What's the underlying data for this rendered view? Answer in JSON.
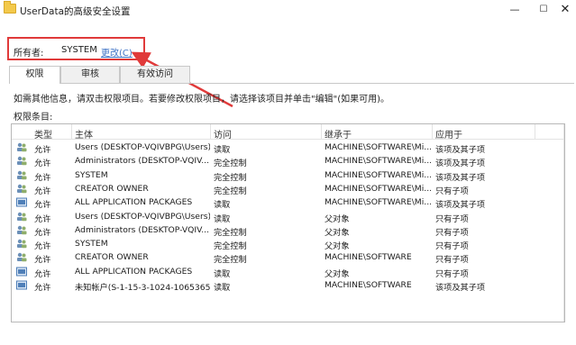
{
  "window": {
    "title": "UserData的高级安全设置",
    "minimize": "—",
    "maximize": "☐",
    "close": "✕"
  },
  "owner": {
    "label": "所有者:",
    "value": "SYSTEM",
    "change_link": "更改(C)"
  },
  "tabs": [
    {
      "label": "权限",
      "active": true
    },
    {
      "label": "审核",
      "active": false
    },
    {
      "label": "有效访问",
      "active": false
    }
  ],
  "instructions": "如需其他信息，请双击权限项目。若要修改权限项目，请选择该项目并单击\"编辑\"(如果可用)。",
  "entries_label": "权限条目:",
  "table": {
    "headers": [
      "类型",
      "主体",
      "访问",
      "继承于",
      "应用于"
    ],
    "rows": [
      {
        "icon": "users-icon",
        "type": "允许",
        "principal": "Users (DESKTOP-VQIVBPG\\Users)",
        "access": "读取",
        "inherited": "MACHINE\\SOFTWARE\\Mi...",
        "applies": "该项及其子项"
      },
      {
        "icon": "users-icon",
        "type": "允许",
        "principal": "Administrators (DESKTOP-VQIV...",
        "access": "完全控制",
        "inherited": "MACHINE\\SOFTWARE\\Mi...",
        "applies": "该项及其子项"
      },
      {
        "icon": "users-icon",
        "type": "允许",
        "principal": "SYSTEM",
        "access": "完全控制",
        "inherited": "MACHINE\\SOFTWARE\\Mi...",
        "applies": "该项及其子项"
      },
      {
        "icon": "users-icon",
        "type": "允许",
        "principal": "CREATOR OWNER",
        "access": "完全控制",
        "inherited": "MACHINE\\SOFTWARE\\Mi...",
        "applies": "只有子项"
      },
      {
        "icon": "package-icon",
        "type": "允许",
        "principal": "ALL APPLICATION PACKAGES",
        "access": "读取",
        "inherited": "MACHINE\\SOFTWARE\\Mi...",
        "applies": "该项及其子项"
      },
      {
        "icon": "users-icon",
        "type": "允许",
        "principal": "Users (DESKTOP-VQIVBPG\\Users)",
        "access": "读取",
        "inherited": "父对象",
        "applies": "只有子项"
      },
      {
        "icon": "users-icon",
        "type": "允许",
        "principal": "Administrators (DESKTOP-VQIV...",
        "access": "完全控制",
        "inherited": "父对象",
        "applies": "只有子项"
      },
      {
        "icon": "users-icon",
        "type": "允许",
        "principal": "SYSTEM",
        "access": "完全控制",
        "inherited": "父对象",
        "applies": "只有子项"
      },
      {
        "icon": "users-icon",
        "type": "允许",
        "principal": "CREATOR OWNER",
        "access": "完全控制",
        "inherited": "MACHINE\\SOFTWARE",
        "applies": "只有子项"
      },
      {
        "icon": "package-icon",
        "type": "允许",
        "principal": "ALL APPLICATION PACKAGES",
        "access": "读取",
        "inherited": "父对象",
        "applies": "只有子项"
      },
      {
        "icon": "package-icon",
        "type": "允许",
        "principal": "未知帐户(S-1-15-3-1024-1065365...",
        "access": "读取",
        "inherited": "MACHINE\\SOFTWARE",
        "applies": "该项及其子项"
      }
    ]
  },
  "colors": {
    "highlight_box": "#e03a3a",
    "link": "#3f73c5",
    "folder": "#f3c94b"
  }
}
